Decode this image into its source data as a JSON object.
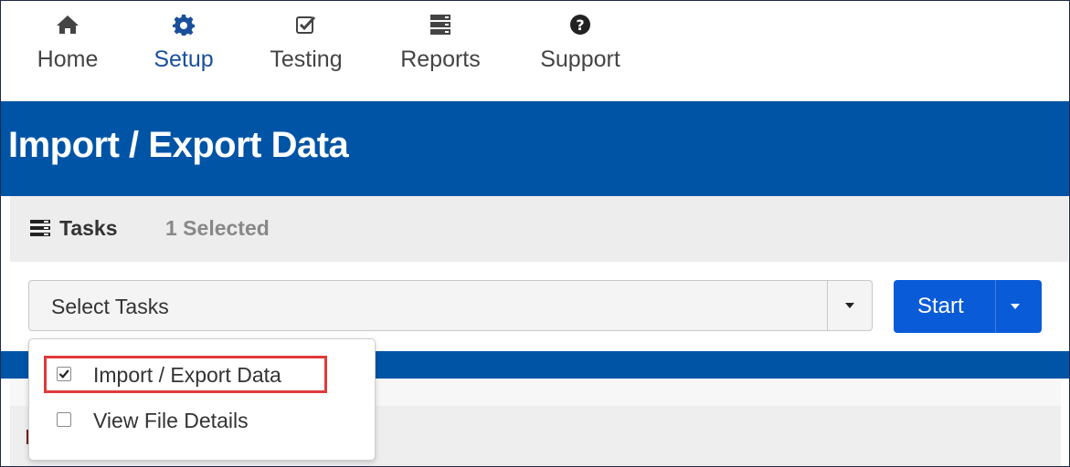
{
  "nav": {
    "items": [
      {
        "label": "Home",
        "icon": "home-icon"
      },
      {
        "label": "Setup",
        "icon": "gear-icon"
      },
      {
        "label": "Testing",
        "icon": "checkbox-icon"
      },
      {
        "label": "Reports",
        "icon": "server-icon"
      },
      {
        "label": "Support",
        "icon": "question-icon"
      }
    ],
    "active": "Setup"
  },
  "header": {
    "title": "Import / Export Data"
  },
  "tasks": {
    "label": "Tasks",
    "selected_count": "1 Selected",
    "select": {
      "value": "Select Tasks"
    },
    "start_label": "Start",
    "options": [
      {
        "label": "Import / Export Data",
        "checked": true
      },
      {
        "label": "View File Details",
        "checked": false
      }
    ]
  },
  "colors": {
    "brand_blue": "#0054a6",
    "button_blue": "#0a5bd8",
    "active_nav": "#1a4f9c",
    "highlight_red": "#e0393c"
  }
}
